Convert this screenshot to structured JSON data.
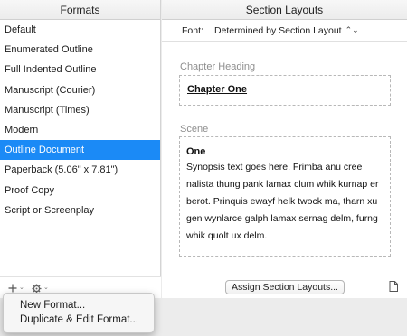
{
  "left_pane": {
    "header": "Formats",
    "formats": [
      {
        "label": "Default",
        "selected": false
      },
      {
        "label": "Enumerated Outline",
        "selected": false
      },
      {
        "label": "Full Indented Outline",
        "selected": false
      },
      {
        "label": "Manuscript (Courier)",
        "selected": false
      },
      {
        "label": "Manuscript (Times)",
        "selected": false
      },
      {
        "label": "Modern",
        "selected": false
      },
      {
        "label": "Outline Document",
        "selected": true
      },
      {
        "label": "Paperback (5.06\" x 7.81\")",
        "selected": false
      },
      {
        "label": "Proof Copy",
        "selected": false
      },
      {
        "label": "Script or Screenplay",
        "selected": false
      }
    ],
    "toolbar": {
      "add_icon": "plus-icon",
      "gear_icon": "gear-icon"
    }
  },
  "right_pane": {
    "header": "Section Layouts",
    "font_label": "Font:",
    "font_value": "Determined by Section Layout",
    "chapter_heading": {
      "title": "Chapter Heading",
      "sample": "Chapter One"
    },
    "scene": {
      "title": "Scene",
      "sample_title": "One",
      "sample_body": "Synopsis text goes here. Frimba anu cree nalista thung pank lamax clum whik kurnap er berot. Prinquis ewayf helk twock ma, tharn xu gen wynlarce galph lamax sernag delm, furng whik quolt ux delm."
    },
    "assign_button": "Assign Section Layouts...",
    "doc_icon": "document-icon"
  },
  "popup_menu": {
    "items": [
      "New Format...",
      "Duplicate & Edit Format..."
    ]
  },
  "colors": {
    "selection": "#1b8af6",
    "pane_bg": "#ffffff",
    "window_bg": "#ececec"
  }
}
